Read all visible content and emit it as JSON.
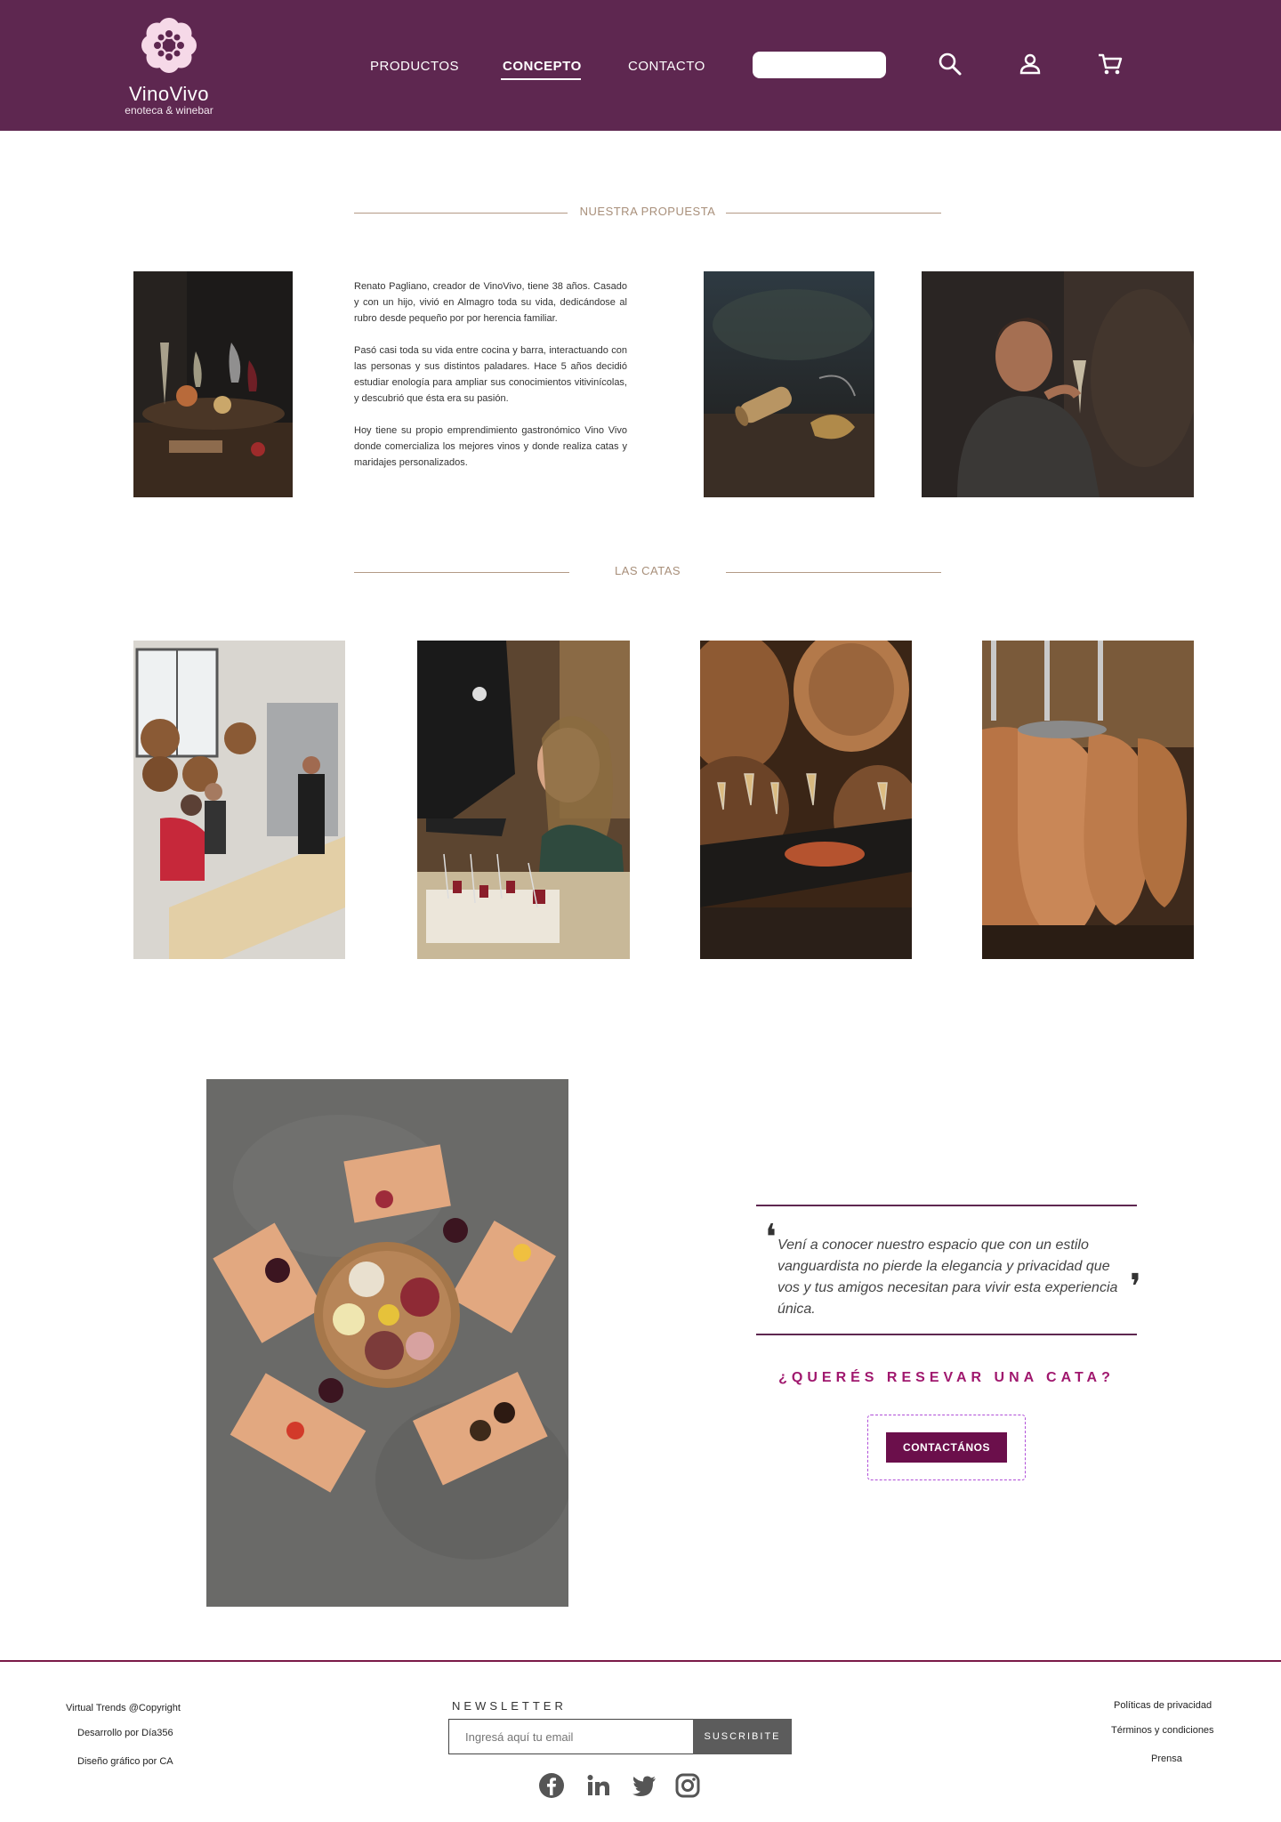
{
  "header": {
    "logo_name": "VinoVivo",
    "logo_sub": "enoteca & winebar",
    "nav": [
      "PRODUCTOS",
      "CONCEPTO",
      "CONTACTO"
    ],
    "search_placeholder": "",
    "icons": [
      "search-icon",
      "user-icon",
      "cart-icon"
    ],
    "brand_color": "#5e2750"
  },
  "propuesta": {
    "title": "NUESTRA PROPUESTA",
    "paragraphs": [
      "Renato Pagliano, creador de VinoVivo, tiene 38 años. Casado y con un hijo, vivió en Almagro toda su vida, dedicándose al rubro desde pequeño por por herencia familiar.",
      "Pasó casi toda su vida entre cocina y barra, interactuando con las personas y sus distintos paladares. Hace 5 años decidió estudiar enología para ampliar sus conocimientos vitivinícolas, y descubrió que ésta era su pasión.",
      "Hoy tiene su propio emprendimiento gastronómico Vino Vivo donde comercializa los mejores vinos y donde realiza catas y maridajes personalizados."
    ]
  },
  "catas": {
    "title": "LAS CATAS"
  },
  "reserva": {
    "quote": "Vení a conocer nuestro espacio que con un estilo vanguardista no pierde la elegancia y privacidad que vos y tus amigos necesitan para vivir esta experiencia única.",
    "cta_title": "¿QUERÉS RESEVAR UNA CATA?",
    "cta_button": "CONTACTÁNOS",
    "accent_color": "#a0186e"
  },
  "footer": {
    "left_links": [
      "Virtual Trends @Copyright",
      "Desarrollo por Día356",
      "Diseño gráfico por CA"
    ],
    "newsletter_title": "NEWSLETTER",
    "newsletter_placeholder": "Ingresá aquí tu email",
    "newsletter_button": "SUSCRIBITE",
    "right_links": [
      "Políticas de privacidad",
      "Términos y condiciones",
      "Prensa"
    ],
    "social_icons": [
      "facebook-icon",
      "linkedin-icon",
      "twitter-icon",
      "instagram-icon"
    ]
  }
}
